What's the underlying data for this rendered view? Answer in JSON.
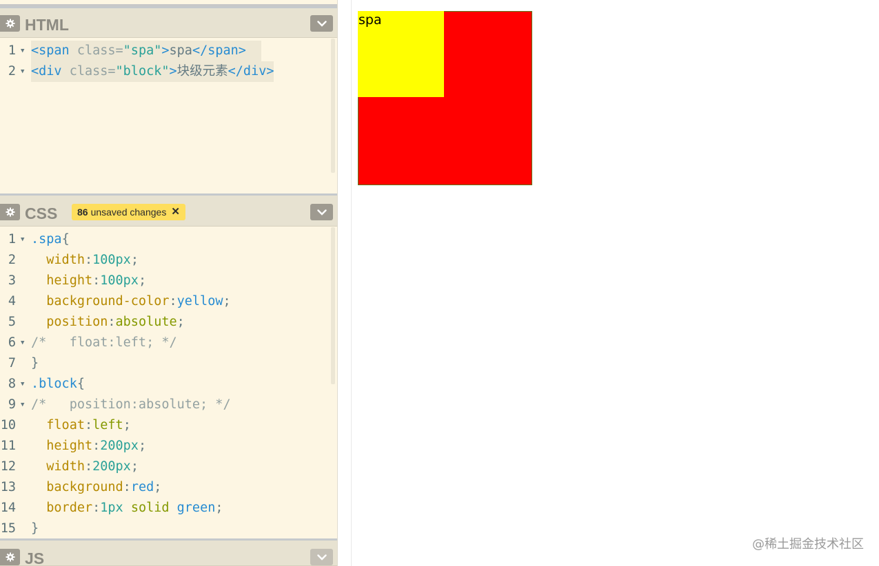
{
  "html_panel": {
    "title": "HTML",
    "lines": [
      {
        "n": "1",
        "parts": [
          [
            "tag",
            "<span"
          ],
          [
            "attr",
            " class="
          ],
          [
            "str",
            "\"spa\""
          ],
          [
            "tag",
            ">"
          ],
          [
            "txt",
            "spa"
          ],
          [
            "tag",
            "</span>"
          ]
        ]
      },
      {
        "n": "2",
        "parts": [
          [
            "tag",
            "<div"
          ],
          [
            "attr",
            " class="
          ],
          [
            "str",
            "\"block\""
          ],
          [
            "tag",
            ">"
          ],
          [
            "txt",
            "块级元素"
          ],
          [
            "tag",
            "</div>"
          ]
        ]
      }
    ]
  },
  "css_panel": {
    "title": "CSS",
    "badge_count": "86",
    "badge_text": "unsaved changes",
    "badge_close": "✕",
    "lines": [
      {
        "n": "1",
        "fold": true,
        "parts": [
          [
            "sel",
            ".spa"
          ],
          [
            "pun",
            "{"
          ]
        ]
      },
      {
        "n": "2",
        "parts": [
          [
            "pun",
            "  "
          ],
          [
            "prop",
            "width"
          ],
          [
            "pun",
            ":"
          ],
          [
            "num",
            "100px"
          ],
          [
            "pun",
            ";"
          ]
        ]
      },
      {
        "n": "3",
        "parts": [
          [
            "pun",
            "  "
          ],
          [
            "prop",
            "height"
          ],
          [
            "pun",
            ":"
          ],
          [
            "num",
            "100px"
          ],
          [
            "pun",
            ";"
          ]
        ]
      },
      {
        "n": "4",
        "parts": [
          [
            "pun",
            "  "
          ],
          [
            "prop",
            "background-color"
          ],
          [
            "pun",
            ":"
          ],
          [
            "col",
            "yellow"
          ],
          [
            "pun",
            ";"
          ]
        ]
      },
      {
        "n": "5",
        "parts": [
          [
            "pun",
            "  "
          ],
          [
            "prop",
            "position"
          ],
          [
            "pun",
            ":"
          ],
          [
            "kw",
            "absolute"
          ],
          [
            "pun",
            ";"
          ]
        ]
      },
      {
        "n": "6",
        "fold": true,
        "parts": [
          [
            "cmt",
            "/*   float:left; */"
          ]
        ]
      },
      {
        "n": "7",
        "parts": [
          [
            "pun",
            "}"
          ]
        ]
      },
      {
        "n": "8",
        "fold": true,
        "parts": [
          [
            "sel",
            ".block"
          ],
          [
            "pun",
            "{"
          ]
        ]
      },
      {
        "n": "9",
        "fold": true,
        "parts": [
          [
            "cmt",
            "/*   position:absolute; */"
          ]
        ]
      },
      {
        "n": "10",
        "parts": [
          [
            "pun",
            "  "
          ],
          [
            "prop",
            "float"
          ],
          [
            "pun",
            ":"
          ],
          [
            "kw",
            "left"
          ],
          [
            "pun",
            ";"
          ]
        ]
      },
      {
        "n": "11",
        "parts": [
          [
            "pun",
            "  "
          ],
          [
            "prop",
            "height"
          ],
          [
            "pun",
            ":"
          ],
          [
            "num",
            "200px"
          ],
          [
            "pun",
            ";"
          ]
        ]
      },
      {
        "n": "12",
        "parts": [
          [
            "pun",
            "  "
          ],
          [
            "prop",
            "width"
          ],
          [
            "pun",
            ":"
          ],
          [
            "num",
            "200px"
          ],
          [
            "pun",
            ";"
          ]
        ]
      },
      {
        "n": "13",
        "parts": [
          [
            "pun",
            "  "
          ],
          [
            "prop",
            "background"
          ],
          [
            "pun",
            ":"
          ],
          [
            "col",
            "red"
          ],
          [
            "pun",
            ";"
          ]
        ]
      },
      {
        "n": "14",
        "parts": [
          [
            "pun",
            "  "
          ],
          [
            "prop",
            "border"
          ],
          [
            "pun",
            ":"
          ],
          [
            "num",
            "1px"
          ],
          [
            "pun",
            " "
          ],
          [
            "kw",
            "solid"
          ],
          [
            "pun",
            " "
          ],
          [
            "col",
            "green"
          ],
          [
            "pun",
            ";"
          ]
        ]
      },
      {
        "n": "15",
        "parts": [
          [
            "pun",
            "}"
          ]
        ]
      }
    ]
  },
  "js_panel": {
    "title": "JS"
  },
  "preview": {
    "spa_text": "spa",
    "spa_color": "#ffff00",
    "block_color": "#ff0000",
    "block_border_color": "#008000",
    "watermark": "@稀土掘金技术社区"
  }
}
